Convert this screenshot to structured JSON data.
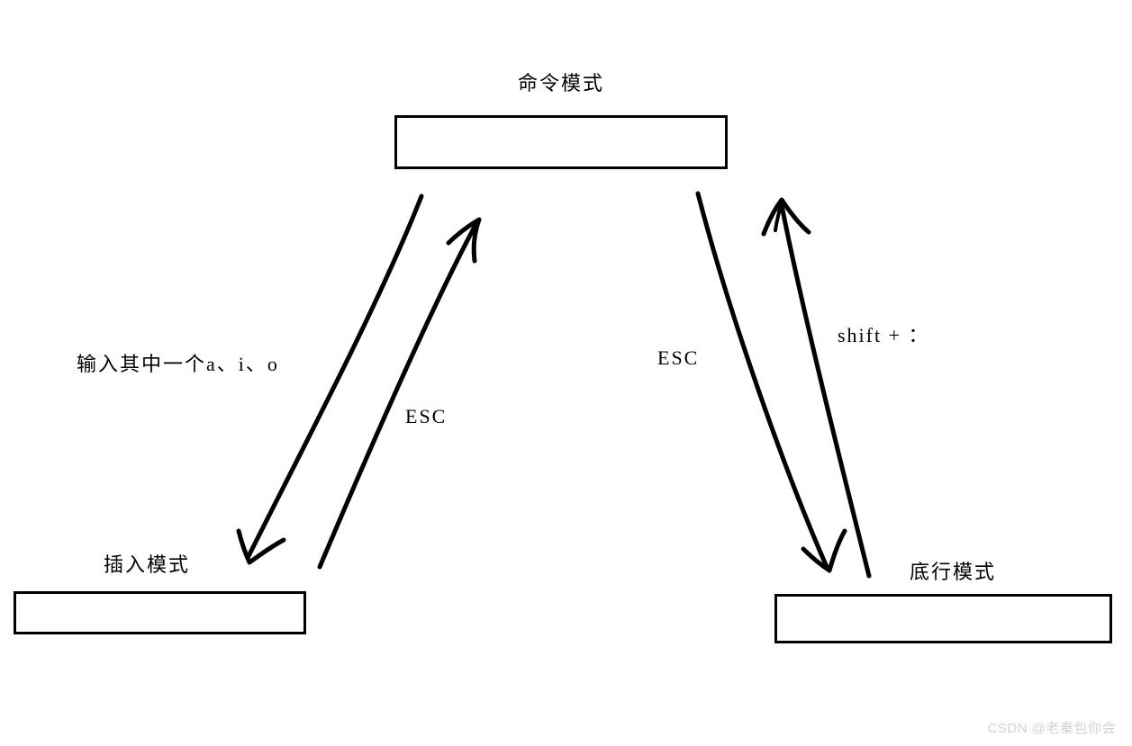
{
  "nodes": {
    "command": {
      "label": "命令模式"
    },
    "insert": {
      "label": "插入模式"
    },
    "lastline": {
      "label": "底行模式"
    }
  },
  "edges": {
    "to_insert": {
      "label": "输入其中一个a、i、o"
    },
    "insert_to_cmd": {
      "label": "ESC"
    },
    "to_lastline": {
      "label": "ESC"
    },
    "lastline_to_cmd": {
      "label": "shift + ："
    }
  },
  "watermark": "CSDN @老秦包你会"
}
